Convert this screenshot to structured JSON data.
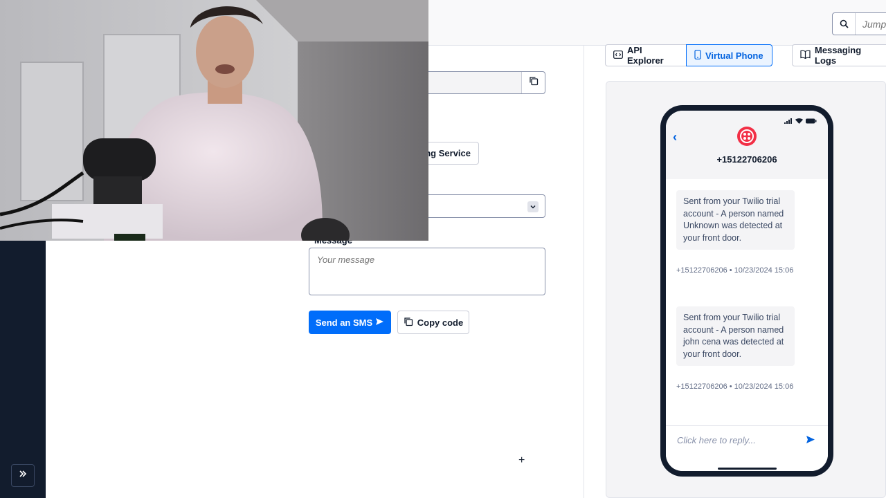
{
  "header": {
    "search": {
      "placeholder": "Jump"
    }
  },
  "form": {
    "service_button_label": "ng Service",
    "message_label": "Message",
    "message_placeholder": "Your message",
    "send_button_label": "Send an SMS",
    "copy_code_label": "Copy code"
  },
  "tabs": [
    {
      "label": "API Explorer",
      "icon": "code-icon",
      "active": false
    },
    {
      "label": "Virtual Phone",
      "icon": "phone-icon",
      "active": true
    },
    {
      "label": "Messaging Logs",
      "icon": "book-icon",
      "active": false
    }
  ],
  "phone": {
    "contact_number": "+15122706206",
    "messages": [
      {
        "text": "Sent from your Twilio trial account - A person named Unknown was detected at your front door.",
        "meta": "+15122706206 • 10/23/2024 15:06"
      },
      {
        "text": "Sent from your Twilio trial account - A person named john cena was detected at your front door.",
        "meta": "+15122706206 • 10/23/2024 15:06"
      }
    ],
    "reply_placeholder": "Click here to reply..."
  },
  "colors": {
    "accent": "#006dfa",
    "rail": "#121c2d",
    "twilio_red": "#f22f46"
  }
}
